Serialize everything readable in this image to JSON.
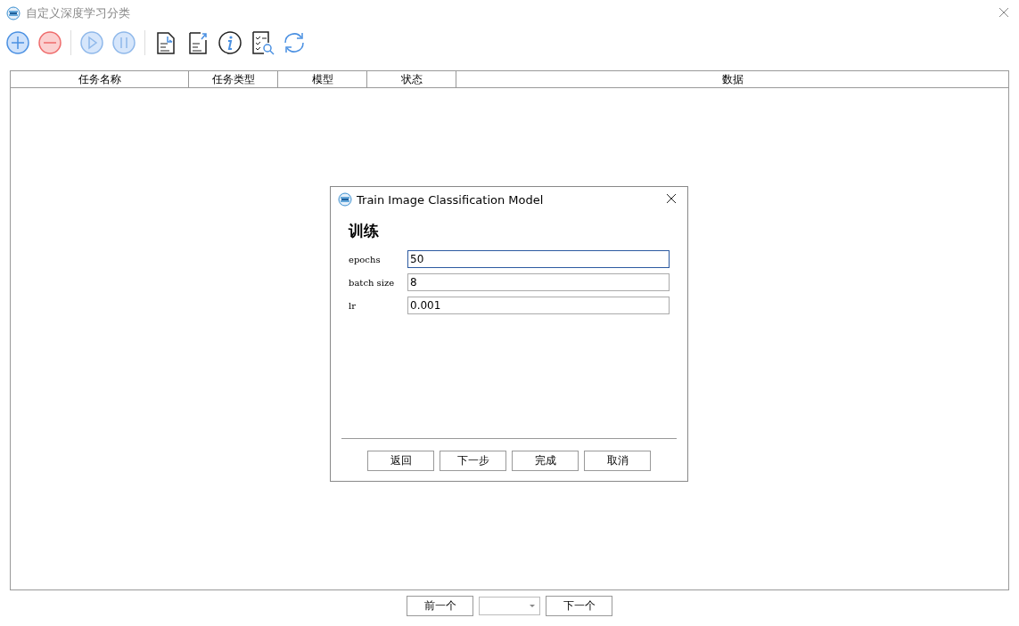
{
  "window": {
    "title": "自定义深度学习分类"
  },
  "table": {
    "columns": [
      "任务名称",
      "任务类型",
      "模型",
      "状态",
      "数据"
    ]
  },
  "dialog": {
    "title": "Train Image Classification Model",
    "heading": "训练",
    "fields": [
      {
        "label": "epochs",
        "value": "50",
        "focused": true
      },
      {
        "label": "batch size",
        "value": "8",
        "focused": false
      },
      {
        "label": "lr",
        "value": "0.001",
        "focused": false
      }
    ],
    "buttons": [
      "返回",
      "下一步",
      "完成",
      "取消"
    ]
  },
  "pager": {
    "prev": "前一个",
    "next": "下一个"
  }
}
